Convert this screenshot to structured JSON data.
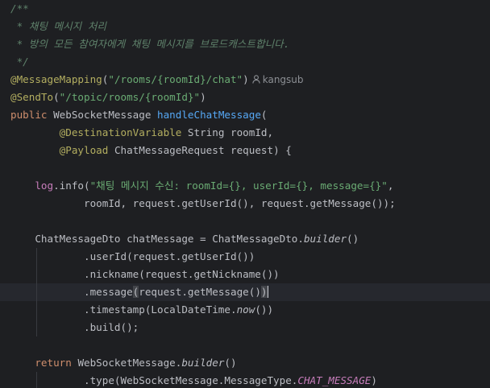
{
  "editor": {
    "comment": {
      "open": "/**",
      "line1": " * 채팅 메시지 처리",
      "line2": " * 방의 모든 참여자에게 채팅 메시지를 브로드캐스트합니다.",
      "close": " */"
    },
    "anno_mapping": "@MessageMapping",
    "mapping_path": "\"/rooms/{roomId}/chat\"",
    "author": "kangsub",
    "anno_sendto": "@SendTo",
    "sendto_path": "\"/topic/rooms/{roomId}\"",
    "kw_public": "public",
    "return_type": "WebSocketMessage",
    "method_name": "handleChatMessage",
    "anno_destvar": "@DestinationVariable",
    "type_string": "String",
    "param_roomid": "roomId,",
    "anno_payload": "@Payload",
    "type_request": "ChatMessageRequest",
    "param_request": "request) {",
    "log_field": "log",
    "log_call": ".info(",
    "log_message": "\"채팅 메시지 수신: roomId={}, userId={}, message={}\"",
    "log_args": "roomId, request.getUserId(), request.getMessage());",
    "dto_decl": "ChatMessageDto chatMessage = ChatMessageDto.",
    "builder_call": "builder",
    "parens_open": "()",
    "userid_call": ".userId(request.getUserId())",
    "nickname_call": ".nickname(request.getNickname())",
    "message_method": ".message",
    "message_args": "request.getMessage()",
    "timestamp_pre": ".timestamp(LocalDateTime.",
    "now_call": "now",
    "timestamp_post": "())",
    "build_call": ".build();",
    "kw_return": "return",
    "ws_class": "WebSocketMessage.",
    "type_pre": ".type(WebSocketMessage.MessageType.",
    "const_chat": "CHAT_MESSAGE",
    "close_paren": ")"
  }
}
